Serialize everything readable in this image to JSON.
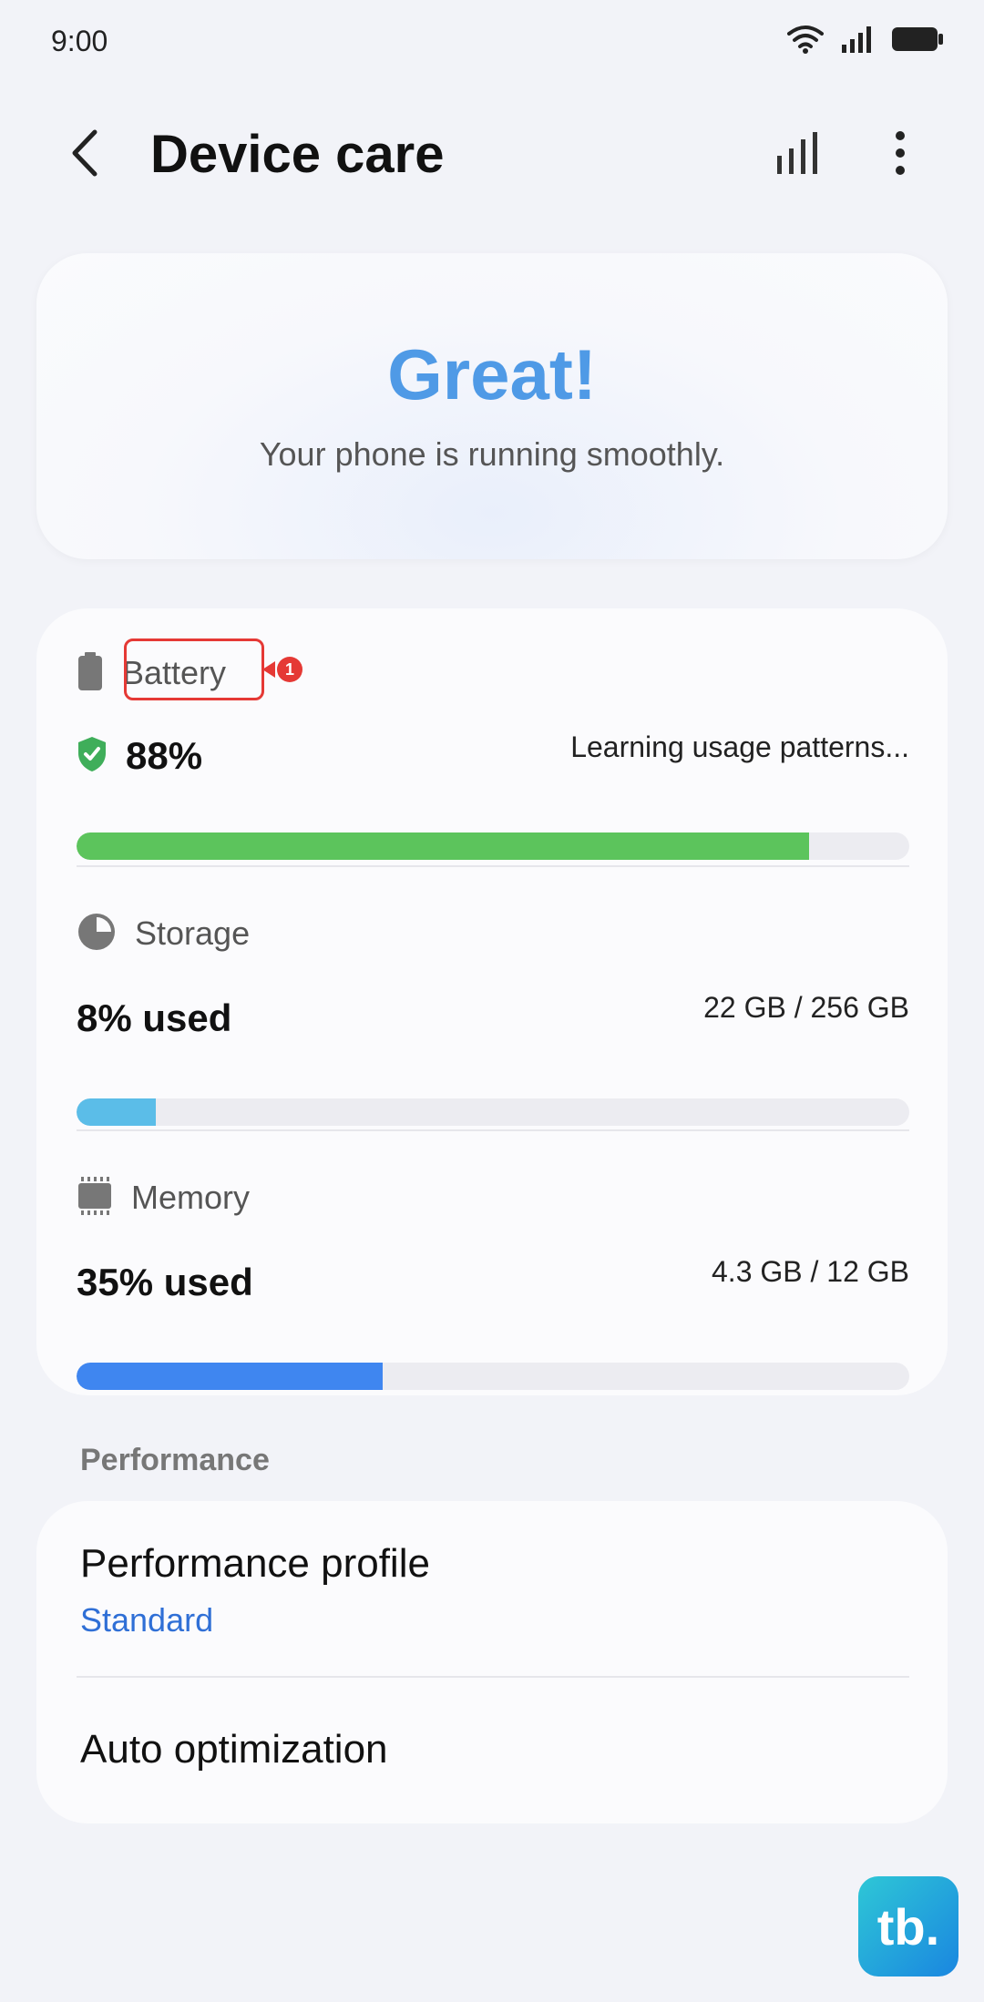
{
  "status_bar": {
    "time": "9:00"
  },
  "app_bar": {
    "title": "Device care"
  },
  "hero": {
    "title": "Great!",
    "subtitle": "Your phone is running smoothly."
  },
  "battery": {
    "label": "Battery",
    "percent_text": "88%",
    "status": "Learning usage patterns...",
    "level": 0.88,
    "color": "#5cc45c",
    "annotation_number": "1"
  },
  "storage": {
    "label": "Storage",
    "used_text": "8% used",
    "amount": "22 GB / 256 GB",
    "level": 0.095,
    "color": "#5bbde8"
  },
  "memory": {
    "label": "Memory",
    "used_text": "35% used",
    "amount": "4.3 GB / 12 GB",
    "level": 0.368,
    "color": "#3f86f0"
  },
  "performance": {
    "section_title": "Performance",
    "profile_title": "Performance profile",
    "profile_value": "Standard",
    "auto_title": "Auto optimization"
  },
  "watermark": {
    "text": "tb."
  }
}
